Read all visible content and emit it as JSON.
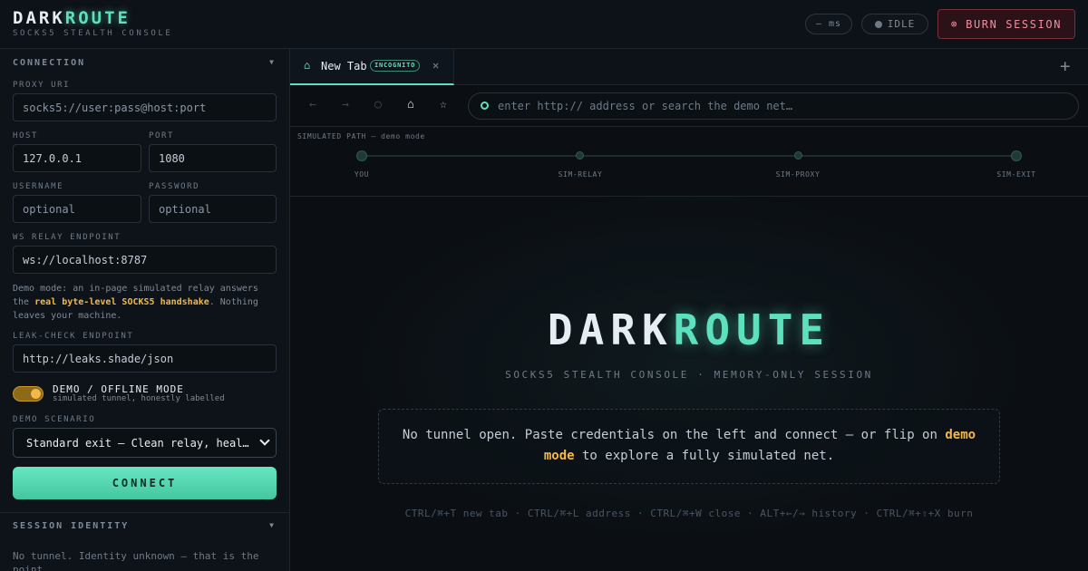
{
  "brand": {
    "title_main": "DARK",
    "title_accent": "ROUTE",
    "subtitle": "SOCKS5 STEALTH CONSOLE"
  },
  "topbar": {
    "latency": "— ms",
    "status": "IDLE",
    "burn_label": "BURN SESSION",
    "burn_icon": "⊗"
  },
  "connection": {
    "heading": "CONNECTION",
    "proxy_uri_label": "PROXY URI",
    "proxy_uri_placeholder": "socks5://user:pass@host:port",
    "host_label": "HOST",
    "host_value": "127.0.0.1",
    "port_label": "PORT",
    "port_value": "1080",
    "username_label": "USERNAME",
    "username_placeholder": "optional",
    "password_label": "PASSWORD",
    "password_placeholder": "optional",
    "relay_label": "WS RELAY ENDPOINT",
    "relay_value": "ws://localhost:8787",
    "demo_note_1": "Demo mode: an in-page simulated relay answers the ",
    "demo_note_hl": "real byte-level SOCKS5 handshake",
    "demo_note_2": ". Nothing leaves your machine.",
    "leak_label": "LEAK-CHECK ENDPOINT",
    "leak_value": "http://leaks.shade/json",
    "toggle_title": "DEMO / OFFLINE MODE",
    "toggle_sub": "simulated tunnel, honestly labelled",
    "toggle_on": true,
    "scenario_label": "DEMO SCENARIO",
    "scenario_value": "Standard exit — Clean relay, heal…",
    "connect_label": "CONNECT"
  },
  "identity": {
    "heading": "SESSION IDENTITY",
    "text": "No tunnel. Identity unknown — that is the point."
  },
  "tabs": [
    {
      "title": "New Tab",
      "badge": "INCOGNITO"
    }
  ],
  "nav": {
    "back": "←",
    "forward": "→",
    "reload": "○",
    "home": "⌂",
    "bookmark": "☆",
    "address_placeholder": "enter http:// address or search the demo net…"
  },
  "path": {
    "label": "SIMULATED PATH — demo mode",
    "nodes": [
      "YOU",
      "SIM-RELAY",
      "SIM-PROXY",
      "SIM-EXIT"
    ]
  },
  "hero": {
    "title_main": "DARK",
    "title_accent": "ROUTE",
    "subtitle": "SOCKS5 STEALTH CONSOLE · MEMORY-ONLY SESSION",
    "notice_1": "No tunnel open. Paste credentials on the left and connect — or flip on ",
    "notice_hl": "demo mode",
    "notice_2": " to explore a fully simulated net.",
    "shortcuts": "CTRL/⌘+T new tab · CTRL/⌘+L address · CTRL/⌘+W close · ALT+←/→ history · CTRL/⌘+⇧+X burn"
  },
  "colors": {
    "accent": "#5ce0bd",
    "highlight": "#f2b84b",
    "danger": "#ee8f9f",
    "background": "#0c1015"
  }
}
